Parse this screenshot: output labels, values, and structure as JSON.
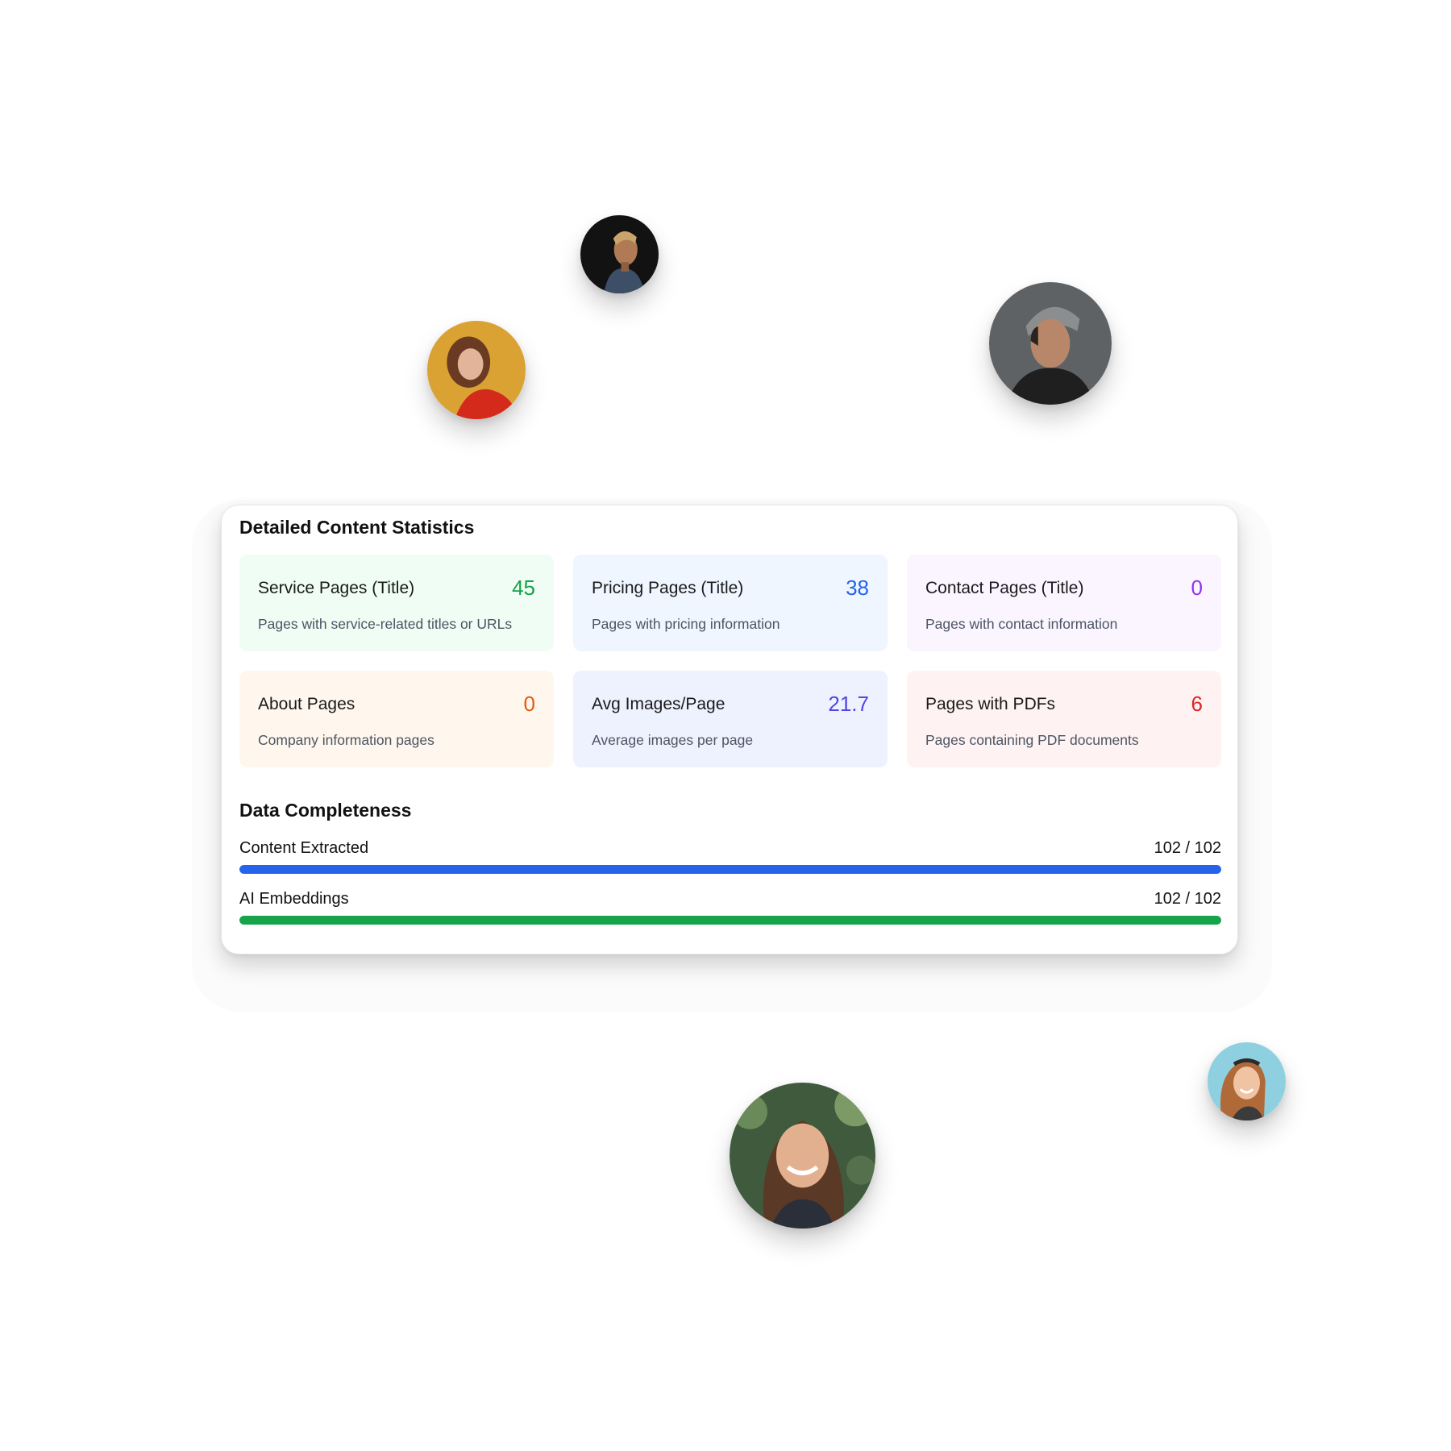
{
  "card": {
    "title": "Detailed Content Statistics",
    "stats": [
      {
        "label": "Service Pages (Title)",
        "value": "45",
        "description": "Pages with service-related titles or URLs",
        "bg": "#f0fdf4",
        "value_color": "#16a34a"
      },
      {
        "label": "Pricing Pages (Title)",
        "value": "38",
        "description": "Pages with pricing information",
        "bg": "#eff6ff",
        "value_color": "#2563eb"
      },
      {
        "label": "Contact Pages (Title)",
        "value": "0",
        "description": "Pages with contact information",
        "bg": "#faf5ff",
        "value_color": "#9333ea"
      },
      {
        "label": "About Pages",
        "value": "0",
        "description": "Company information pages",
        "bg": "#fff7ed",
        "value_color": "#ea580c"
      },
      {
        "label": "Avg Images/Page",
        "value": "21.7",
        "description": "Average images per page",
        "bg": "#eef2ff",
        "value_color": "#4f46e5"
      },
      {
        "label": "Pages with PDFs",
        "value": "6",
        "description": "Pages containing PDF documents",
        "bg": "#fef2f2",
        "value_color": "#dc2626"
      }
    ]
  },
  "completeness": {
    "title": "Data Completeness",
    "rows": [
      {
        "label": "Content Extracted",
        "count": "102 / 102",
        "fraction": 1.0,
        "color": "#2563eb"
      },
      {
        "label": "AI Embeddings",
        "count": "102 / 102",
        "fraction": 1.0,
        "color": "#16a34a"
      }
    ]
  },
  "avatars": [
    "man-profile-photo",
    "woman-red-top-photo",
    "man-beanie-photo",
    "smiling-woman-photo",
    "woman-headband-photo"
  ]
}
